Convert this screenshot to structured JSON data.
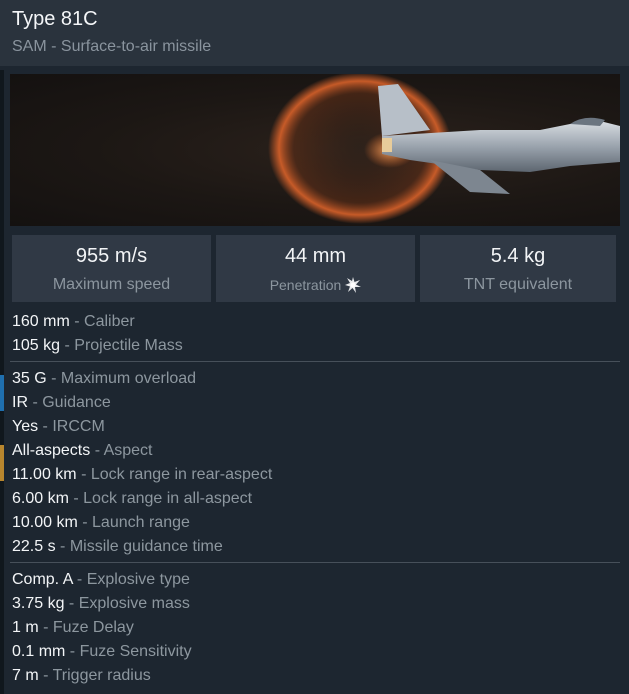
{
  "header": {
    "title": "Type 81C",
    "subtitle": "SAM - Surface-to-air missile"
  },
  "stats": [
    {
      "value": "955 m/s",
      "label": "Maximum speed"
    },
    {
      "value": "44 mm",
      "label": "Penetration"
    },
    {
      "value": "5.4 kg",
      "label": "TNT equivalent"
    }
  ],
  "groups": [
    [
      {
        "value": "160 mm",
        "desc": " - Caliber"
      },
      {
        "value": "105 kg",
        "desc": " - Projectile Mass"
      }
    ],
    [
      {
        "value": "35 G",
        "desc": " - Maximum overload"
      },
      {
        "value": "IR",
        "desc": " - Guidance"
      },
      {
        "value": "Yes",
        "desc": " - IRCCM"
      },
      {
        "value": "All-aspects",
        "desc": " - Aspect"
      },
      {
        "value": "11.00 km",
        "desc": " - Lock range in rear-aspect"
      },
      {
        "value": "6.00 km",
        "desc": " - Lock range in all-aspect"
      },
      {
        "value": "10.00 km",
        "desc": " - Launch range"
      },
      {
        "value": "22.5 s",
        "desc": " - Missile guidance time"
      }
    ],
    [
      {
        "value": "Comp. A",
        "desc": " - Explosive type"
      },
      {
        "value": "3.75 kg",
        "desc": " - Explosive mass"
      },
      {
        "value": "1 m",
        "desc": " - Fuze Delay"
      },
      {
        "value": "0.1 mm",
        "desc": " - Fuze Sensitivity"
      },
      {
        "value": "7 m",
        "desc": " - Trigger radius"
      }
    ]
  ],
  "icons": {
    "penetration": "explosion-burst-icon"
  },
  "colors": {
    "panel": "#1d2630",
    "header": "#2a333d",
    "stat_box": "#303945",
    "label": "#8d979f",
    "value": "#f3f5f7",
    "explosion": "#d9622a"
  }
}
